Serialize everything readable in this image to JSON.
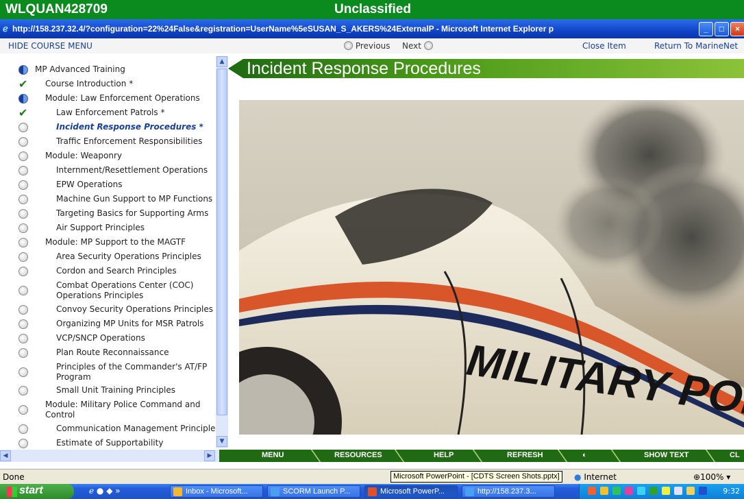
{
  "banner": {
    "left": "WLQUAN428709",
    "center": "Unclassified"
  },
  "window": {
    "title": "http://158.237.32.4/?configuration=22%24False&registration=UserName%5eSUSAN_S_AKERS%24ExternalP - Microsoft Internet Explorer p"
  },
  "nav": {
    "hide_menu": "HIDE COURSE MENU",
    "previous": "Previous",
    "next": "Next",
    "close_item": "Close Item",
    "return": "Return To MarineNet"
  },
  "menu": {
    "items": [
      {
        "label": "MP Advanced Training",
        "icon": "half",
        "indent": 0
      },
      {
        "label": "Course Introduction *",
        "icon": "check",
        "indent": 1
      },
      {
        "label": "Module: Law Enforcement Operations",
        "icon": "half",
        "indent": 1
      },
      {
        "label": "Law Enforcement Patrols *",
        "icon": "check",
        "indent": 2
      },
      {
        "label": "Incident Response Procedures *",
        "icon": "dot",
        "indent": 2,
        "current": true
      },
      {
        "label": "Traffic Enforcement Responsibilities",
        "icon": "dot",
        "indent": 2
      },
      {
        "label": "Module: Weaponry",
        "icon": "dot",
        "indent": 1
      },
      {
        "label": "Internment/Resettlement Operations",
        "icon": "dot",
        "indent": 2
      },
      {
        "label": "EPW Operations",
        "icon": "dot",
        "indent": 2
      },
      {
        "label": "Machine Gun Support to MP Functions",
        "icon": "dot",
        "indent": 2
      },
      {
        "label": "Targeting Basics for Supporting Arms",
        "icon": "dot",
        "indent": 2
      },
      {
        "label": "Air Support Principles",
        "icon": "dot",
        "indent": 2
      },
      {
        "label": "Module: MP Support to the MAGTF",
        "icon": "dot",
        "indent": 1
      },
      {
        "label": "Area Security Operations Principles",
        "icon": "dot",
        "indent": 2
      },
      {
        "label": "Cordon and Search Principles",
        "icon": "dot",
        "indent": 2
      },
      {
        "label": "Combat Operations Center (COC) Operations Principles",
        "icon": "dot",
        "indent": 2,
        "wrap": true
      },
      {
        "label": "Convoy Security Operations Principles",
        "icon": "dot",
        "indent": 2
      },
      {
        "label": "Organizing MP Units for MSR Patrols",
        "icon": "dot",
        "indent": 2
      },
      {
        "label": "VCP/SNCP Operations",
        "icon": "dot",
        "indent": 2
      },
      {
        "label": "Plan Route Reconnaissance",
        "icon": "dot",
        "indent": 2
      },
      {
        "label": "Principles of the Commander's AT/FP Program",
        "icon": "dot",
        "indent": 2,
        "wrap": true
      },
      {
        "label": "Small Unit Training Principles",
        "icon": "dot",
        "indent": 2
      },
      {
        "label": "Module: Military Police Command and Control",
        "icon": "dot",
        "indent": 1,
        "wrap": true
      },
      {
        "label": "Communication Management Principle",
        "icon": "dot",
        "indent": 2
      },
      {
        "label": "Estimate of Supportability",
        "icon": "dot",
        "indent": 2
      }
    ]
  },
  "content": {
    "title": "Incident Response Procedures",
    "car_text": "MILITARY POLICE"
  },
  "bottom_nav": {
    "items": [
      "MENU",
      "RESOURCES",
      "HELP",
      "REFRESH",
      "",
      "SHOW TEXT",
      "CL"
    ]
  },
  "status": {
    "left": "Done",
    "zone": "Internet",
    "zoom": "100%"
  },
  "tooltip": "Microsoft PowerPoint - [CDTS Screen Shots.pptx]",
  "taskbar": {
    "start": "start",
    "buttons": [
      "Inbox - Microsoft...",
      "SCORM Launch P...",
      "Microsoft PowerP...",
      "http://158.237.3..."
    ],
    "clock": "9:32"
  }
}
